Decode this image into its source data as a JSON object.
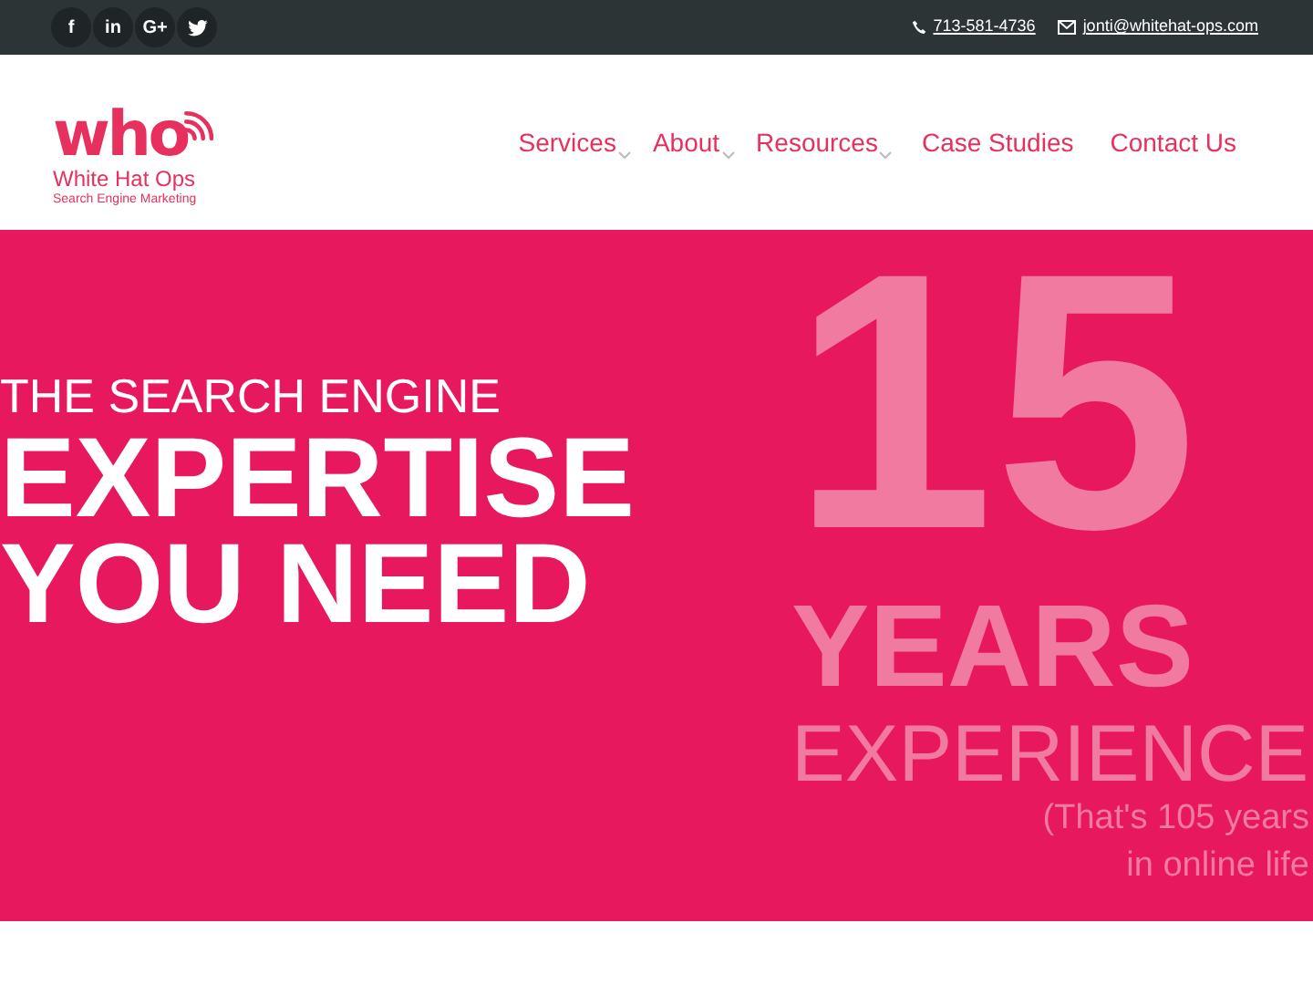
{
  "top_bar": {
    "social": [
      {
        "kind": "facebook",
        "label": "f"
      },
      {
        "kind": "linkedin",
        "label": "in"
      },
      {
        "kind": "googleplus",
        "label": "G+"
      },
      {
        "kind": "twitter"
      }
    ],
    "phone": "713-581-4736",
    "email": "jonti@whitehat-ops.com"
  },
  "logo": {
    "mark": "who",
    "name": "White Hat Ops",
    "tagline": "Search Engine Marketing"
  },
  "nav": [
    {
      "label": "Services",
      "dropdown": true
    },
    {
      "label": "About",
      "dropdown": true
    },
    {
      "label": "Resources",
      "dropdown": true
    },
    {
      "label": "Case Studies",
      "dropdown": false
    },
    {
      "label": "Contact Us",
      "dropdown": false
    }
  ],
  "hero": {
    "kicker": "THE SEARCH ENGINE",
    "headline": [
      "EXPERTISE",
      "YOU NEED"
    ],
    "number": "15",
    "unit": "YEARS",
    "caption": "EXPERIENCE",
    "note": [
      "(That's 105 years",
      "in online life"
    ]
  }
}
